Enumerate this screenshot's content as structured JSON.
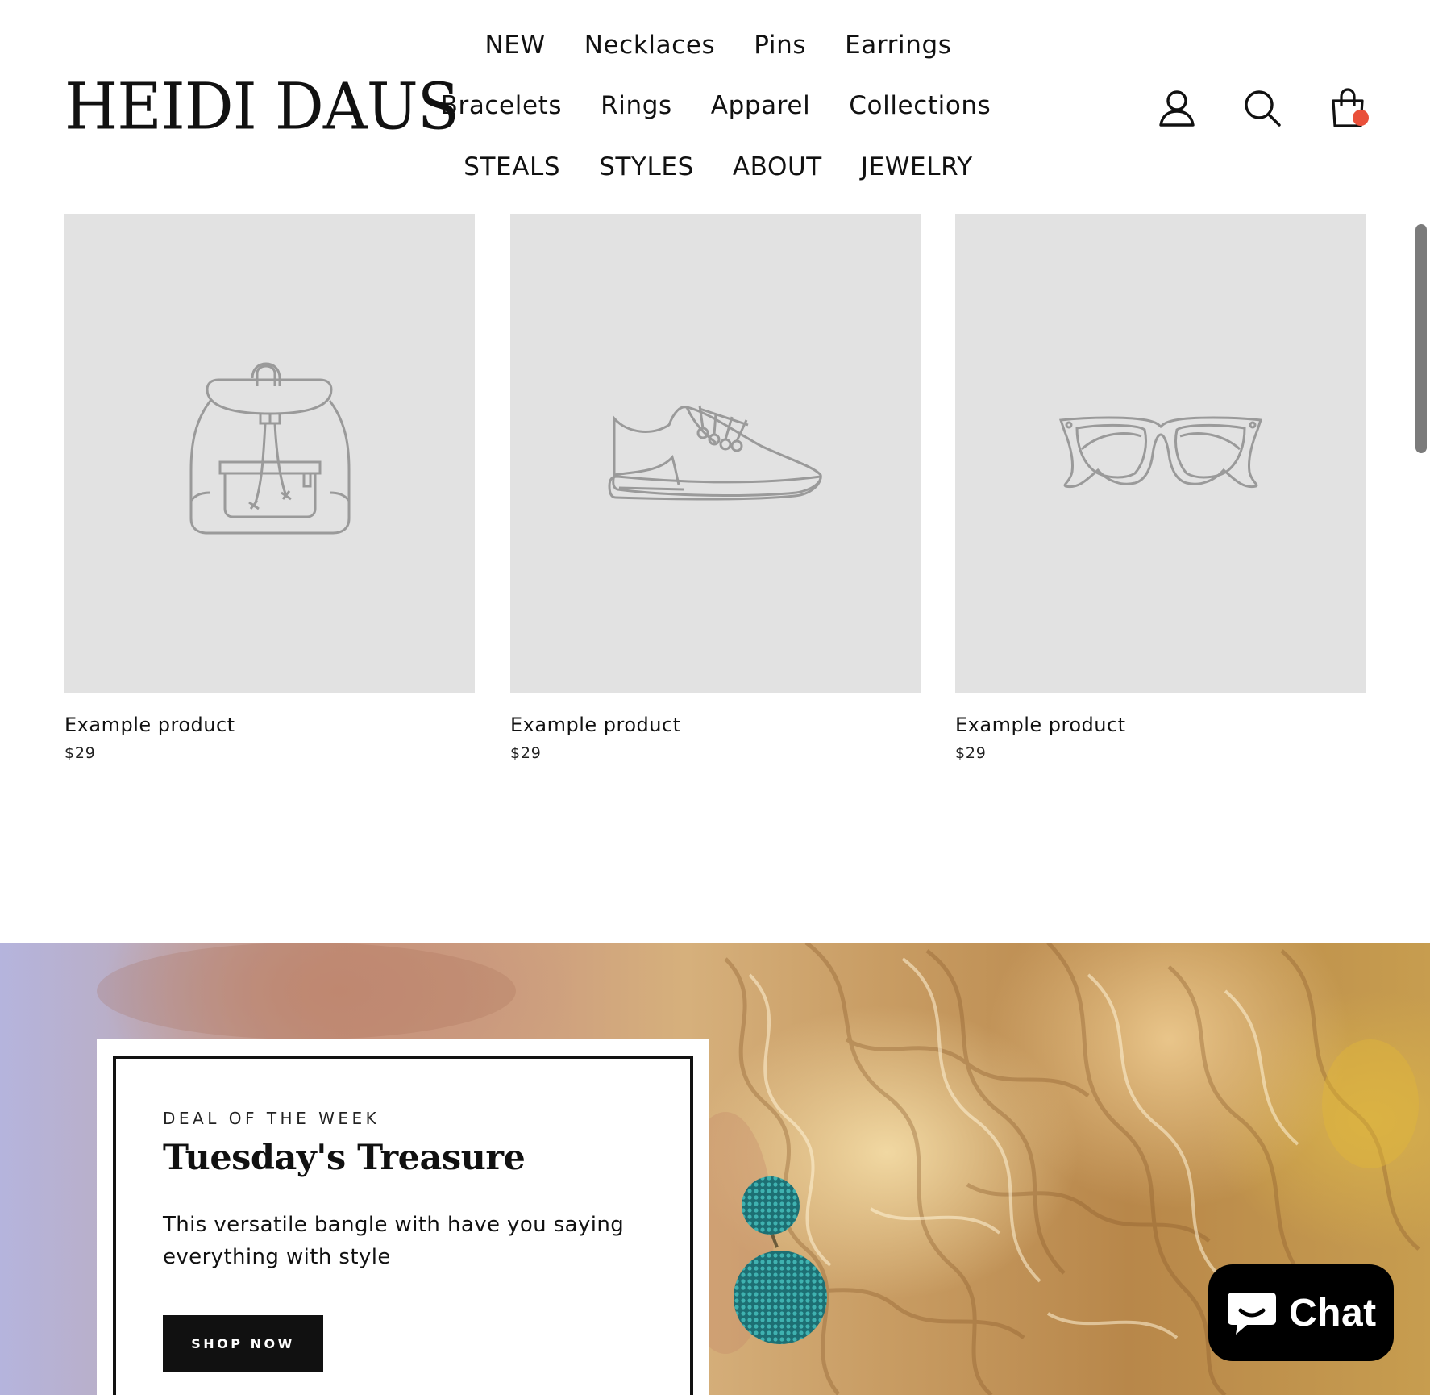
{
  "brand": {
    "logo_text": "HEIDI DAUS"
  },
  "nav": {
    "row1": [
      "NEW",
      "Necklaces",
      "Pins",
      "Earrings"
    ],
    "row2": [
      "Bracelets",
      "Rings",
      "Apparel",
      "Collections"
    ],
    "row3": [
      "STEALS",
      "STYLES",
      "ABOUT",
      "JEWELRY"
    ]
  },
  "header_icons": [
    "account-icon",
    "search-icon",
    "cart-icon"
  ],
  "colors": {
    "cart_badge": "#e9503a",
    "placeholder_bg": "#e2e2e2",
    "placeholder_line": "#9a9a9a",
    "button_bg": "#111111"
  },
  "products": [
    {
      "image": "backpack-icon",
      "title": "Example product",
      "price": "$29"
    },
    {
      "image": "sneaker-icon",
      "title": "Example product",
      "price": "$29"
    },
    {
      "image": "sunglasses-icon",
      "title": "Example product",
      "price": "$29"
    }
  ],
  "deal": {
    "eyebrow": "DEAL OF THE WEEK",
    "title": "Tuesday's Treasure",
    "text": "This versatile bangle with have you saying everything with style",
    "button": "SHOP NOW"
  },
  "chat": {
    "label": "Chat"
  }
}
